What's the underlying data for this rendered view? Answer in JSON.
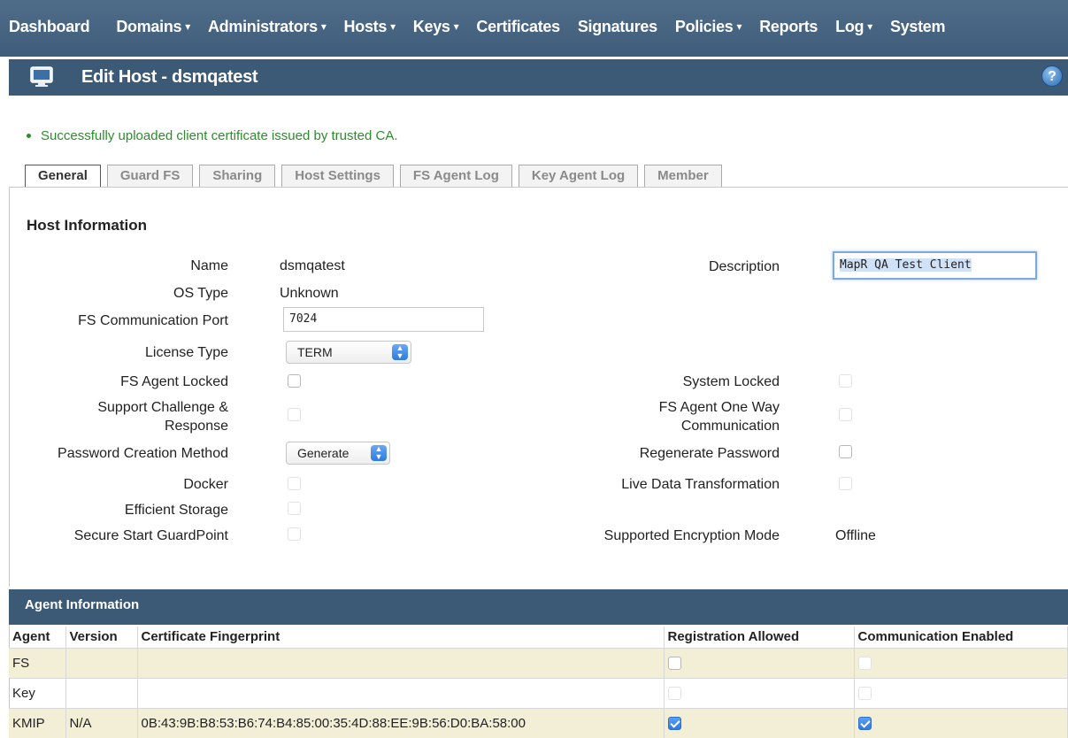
{
  "nav": {
    "items": [
      {
        "label": "Dashboard",
        "caret": false
      },
      {
        "label": "Domains",
        "caret": true
      },
      {
        "label": "Administrators",
        "caret": true
      },
      {
        "label": "Hosts",
        "caret": true
      },
      {
        "label": "Keys",
        "caret": true
      },
      {
        "label": "Certificates",
        "caret": false
      },
      {
        "label": "Signatures",
        "caret": false
      },
      {
        "label": "Policies",
        "caret": true
      },
      {
        "label": "Reports",
        "caret": false
      },
      {
        "label": "Log",
        "caret": true
      },
      {
        "label": "System",
        "caret": false
      }
    ],
    "caret_glyph": "▾"
  },
  "header": {
    "title": "Edit Host - dsmqatest",
    "help": "?"
  },
  "message": "Successfully uploaded client certificate issued by trusted CA.",
  "tabs": [
    "General",
    "Guard FS",
    "Sharing",
    "Host Settings",
    "FS Agent Log",
    "Key Agent Log",
    "Member"
  ],
  "active_tab": "General",
  "host": {
    "section_title": "Host Information",
    "name_label": "Name",
    "name_value": "dsmqatest",
    "os_label": "OS Type",
    "os_value": "Unknown",
    "port_label": "FS Communication Port",
    "port_value": "7024",
    "license_label": "License Type",
    "license_value": "TERM",
    "fs_locked_label": "FS Agent Locked",
    "challenge_label_1": "Support Challenge &",
    "challenge_label_2": "Response",
    "pwd_method_label": "Password Creation Method",
    "pwd_method_value": "Generate",
    "docker_label": "Docker",
    "efficient_label": "Efficient Storage",
    "secure_start_label": "Secure Start GuardPoint",
    "description_label": "Description",
    "description_value": "MapR QA Test Client",
    "system_locked_label": "System Locked",
    "one_way_label_1": "FS Agent One Way",
    "one_way_label_2": "Communication",
    "regen_label": "Regenerate Password",
    "ldt_label": "Live Data Transformation",
    "enc_mode_label": "Supported Encryption Mode",
    "enc_mode_value": "Offline"
  },
  "agent_info": {
    "title": "Agent Information",
    "columns": [
      "Agent",
      "Version",
      "Certificate Fingerprint",
      "Registration Allowed",
      "Communication Enabled"
    ],
    "rows": [
      {
        "agent": "FS",
        "version": "",
        "fingerprint": "",
        "registration": false,
        "communication": false
      },
      {
        "agent": "Key",
        "version": "",
        "fingerprint": "",
        "registration": false,
        "communication": false
      },
      {
        "agent": "KMIP",
        "version": "N/A",
        "fingerprint": "0B:43:9B:B8:53:B6:74:B4:85:00:35:4D:88:EE:9B:56:D0:BA:58:00",
        "registration": true,
        "communication": true
      }
    ]
  },
  "colors": {
    "nav_bg": "#44627f",
    "header_bg": "#3c5a76",
    "success": "#2e8b2e",
    "row_highlight": "#f3efd7"
  }
}
